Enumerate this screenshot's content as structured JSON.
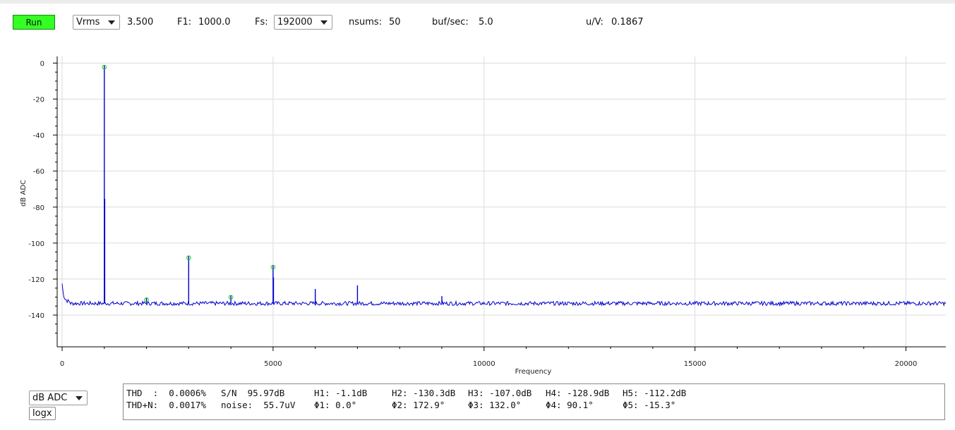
{
  "toolbar": {
    "run_label": "Run",
    "mode_select": "Vrms",
    "mode_value": "3.500",
    "f1_label": "F1:",
    "f1_value": "1000.0",
    "fs_label": "Fs:",
    "fs_select": "192000",
    "nsums_label": "nsums:",
    "nsums_value": "50",
    "bufsec_label": "buf/sec:",
    "bufsec_value": "5.0",
    "uv_label": "u/V:",
    "uv_value": "0.1867"
  },
  "controls": {
    "units_select": "dB ADC",
    "logx_label": "logx"
  },
  "stats": {
    "row1": [
      {
        "label": "THD  :",
        "value": "0.0006%"
      },
      {
        "label": "S/N",
        "value": "95.97dB"
      },
      {
        "label": "H1:",
        "value": "-1.1dB"
      },
      {
        "label": "H2:",
        "value": "-130.3dB"
      },
      {
        "label": "H3:",
        "value": "-107.0dB"
      },
      {
        "label": "H4:",
        "value": "-128.9dB"
      },
      {
        "label": "H5:",
        "value": "-112.2dB"
      }
    ],
    "row2": [
      {
        "label": "THD+N:",
        "value": "0.0017%"
      },
      {
        "label": "noise:",
        "value": "55.7uV"
      },
      {
        "label": "Φ1:",
        "value": "0.0°"
      },
      {
        "label": "Φ2:",
        "value": "172.9°"
      },
      {
        "label": "Φ3:",
        "value": "132.0°"
      },
      {
        "label": "Φ4:",
        "value": "90.1°"
      },
      {
        "label": "Φ5:",
        "value": "-15.3°"
      }
    ]
  },
  "chart_data": {
    "type": "line",
    "xlabel": "Frequency",
    "ylabel": "dB ADC",
    "xlim": [
      0,
      21000
    ],
    "ylim": [
      -150,
      3
    ],
    "x_ticks": [
      0,
      5000,
      10000,
      15000,
      20000
    ],
    "x_tick_labels": [
      "0",
      "5000",
      "10000",
      "15000",
      "20000"
    ],
    "y_ticks": [
      0,
      -20,
      -40,
      -60,
      -80,
      -100,
      -120,
      -140
    ],
    "y_tick_labels": [
      "0",
      "-20",
      "-40",
      "-60",
      "-80",
      "-100",
      "-120",
      "-140"
    ],
    "grid": true,
    "series_color": "#0000cc",
    "marker_color": "#22cc22",
    "noise_floor": -133.5,
    "peaks": [
      {
        "x": 1000,
        "y": -1.1
      },
      {
        "x": 1010,
        "y": -75.5
      },
      {
        "x": 2000,
        "y": -130.3
      },
      {
        "x": 3000,
        "y": -107.0
      },
      {
        "x": 4000,
        "y": -128.9
      },
      {
        "x": 5000,
        "y": -112.2
      },
      {
        "x": 5010,
        "y": -119.0
      },
      {
        "x": 6000,
        "y": -125.5
      },
      {
        "x": 7000,
        "y": -123.5
      },
      {
        "x": 9000,
        "y": -129.5
      }
    ],
    "harmonic_markers": [
      {
        "x": 1000,
        "y": -1.1
      },
      {
        "x": 2000,
        "y": -130.3
      },
      {
        "x": 3000,
        "y": -107.0
      },
      {
        "x": 4000,
        "y": -128.9
      },
      {
        "x": 5000,
        "y": -112.2
      }
    ]
  }
}
